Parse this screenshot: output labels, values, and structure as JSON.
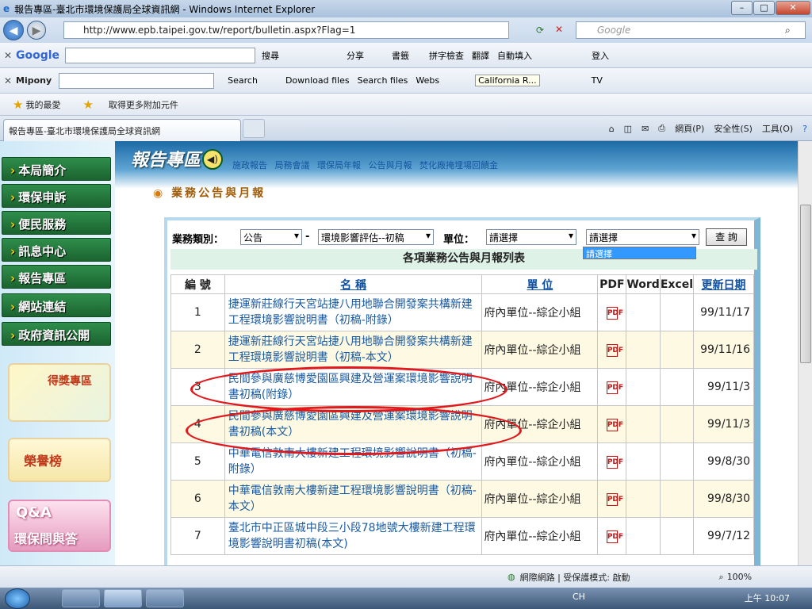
{
  "window": {
    "title": "報告專區-臺北市環境保護局全球資訊網 - Windows Internet Explorer",
    "min": "–",
    "max": "□",
    "close": "✕"
  },
  "address": {
    "url": "http://www.epb.taipei.gov.tw/report/bulletin.aspx?Flag=1",
    "search_placeholder": "Google"
  },
  "toolbar1": {
    "brand": "Google",
    "items": [
      "搜尋",
      "分享",
      "書籤",
      "拼字檢查",
      "翻譯",
      "自動填入",
      "登入"
    ]
  },
  "toolbar2": {
    "brand": "Mipony",
    "items": [
      "Search",
      "Download files",
      "Search files",
      "Webs",
      "California R...",
      "TV"
    ]
  },
  "favorites": {
    "label": "我的最愛",
    "addons": "取得更多附加元件"
  },
  "tabs": {
    "active": "報告專區-臺北市環境保護局全球資訊網",
    "commands": [
      "網頁(P)",
      "安全性(S)",
      "工具(O)"
    ]
  },
  "leftnav": {
    "items": [
      "本局簡介",
      "環保申訴",
      "便民服務",
      "訊息中心",
      "報告專區",
      "網站連結",
      "政府資訊公開"
    ],
    "promo1": "得獎專區",
    "promo2": "榮譽榜",
    "promo3_top": "Q&A",
    "promo3_bottom": "環保問與答"
  },
  "banner": {
    "logo": "報告專區",
    "links": [
      "施政報告",
      "局務會議",
      "環保局年報",
      "公告與月報",
      "焚化廠掩埋場回饋金"
    ]
  },
  "page_title": "業務公告與月報",
  "filter": {
    "category_label": "業務類別：",
    "category_value": "公告",
    "sep": "-",
    "subcategory_value": "環境影響評估--初稿",
    "unit_label": "單位：",
    "unit_value": "請選擇",
    "unit2_value": "請選擇",
    "dropdown_option": "請選擇",
    "query_button": "查 詢"
  },
  "table": {
    "title": "各項業務公告與月報列表",
    "headers": [
      "編 號",
      "名 稱",
      "單 位",
      "PDF",
      "Word",
      "Excel",
      "更新日期"
    ],
    "rows": [
      {
        "num": "1",
        "name": "捷運新莊線行天宮站捷八用地聯合開發案共構新建工程環境影響說明書（初稿-附錄）",
        "unit": "府內單位--綜企小組",
        "date": "99/11/17"
      },
      {
        "num": "2",
        "name": "捷運新莊線行天宮站捷八用地聯合開發案共構新建工程環境影響說明書（初稿-本文）",
        "unit": "府內單位--綜企小組",
        "date": "99/11/16"
      },
      {
        "num": "3",
        "name": "民間參與廣慈博愛園區興建及營運案環境影響說明書初稿(附錄）",
        "unit": "府內單位--綜企小組",
        "date": "99/11/3"
      },
      {
        "num": "4",
        "name": "民間參與廣慈博愛園區興建及營運案環境影響說明書初稿(本文）",
        "unit": "府內單位--綜企小組",
        "date": "99/11/3"
      },
      {
        "num": "5",
        "name": "中華電信敦南大樓新建工程環境影響說明書（初稿-附錄）",
        "unit": "府內單位--綜企小組",
        "date": "99/8/30"
      },
      {
        "num": "6",
        "name": "中華電信敦南大樓新建工程環境影響說明書（初稿-本文）",
        "unit": "府內單位--綜企小組",
        "date": "99/8/30"
      },
      {
        "num": "7",
        "name": "臺北市中正區城中段三小段78地號大樓新建工程環境影響說明書初稿(本文)",
        "unit": "府內單位--綜企小組",
        "date": "99/7/12"
      }
    ]
  },
  "status": {
    "zone": "網際網路 | 受保護模式: 啟動",
    "zoom": "100%"
  },
  "taskbar": {
    "lang": "CH",
    "clock": "上午 10:07"
  },
  "colors": {
    "nav_green": "#1b6330",
    "link_blue": "#1a5aa0",
    "annotation_red": "#e0191d"
  }
}
